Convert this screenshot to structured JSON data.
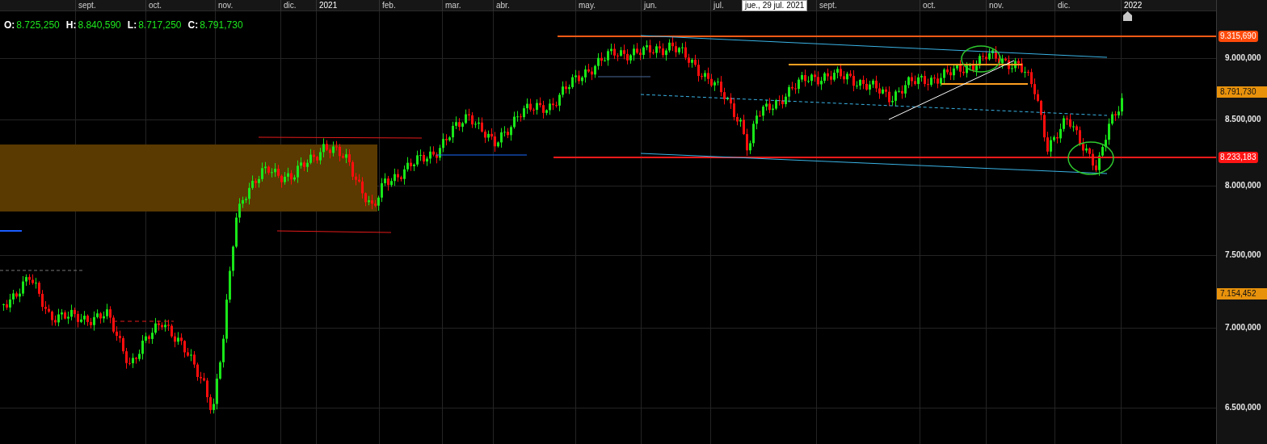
{
  "x_axis": {
    "labels": [
      "sept.",
      "oct.",
      "nov.",
      "dic.",
      "2021",
      "feb.",
      "mar.",
      "abr.",
      "may.",
      "jun.",
      "jul.",
      "sept.",
      "oct.",
      "nov.",
      "dic.",
      "2022"
    ]
  },
  "crosshair_label": "jue., 29 jul. 2021",
  "ohlc": [
    {
      "label": "O:",
      "value": "8.725,250"
    },
    {
      "label": "H:",
      "value": "8.840,590"
    },
    {
      "label": "L:",
      "value": "8.717,250"
    },
    {
      "label": "C:",
      "value": "8.791,730"
    }
  ],
  "price_axis": {
    "ticks": [
      "9.000,000",
      "8.500,000",
      "8.000,000",
      "7.500,000",
      "7.000,000",
      "6.500,000"
    ]
  },
  "price_tags": [
    {
      "text": "9.315,690",
      "color": "#ff4a0a"
    },
    {
      "text": "8.791,730",
      "color": "#e8920c"
    },
    {
      "text": "8.233,183",
      "color": "#ff1414"
    },
    {
      "text": "7.154,452",
      "color": "#e8920c"
    }
  ]
}
